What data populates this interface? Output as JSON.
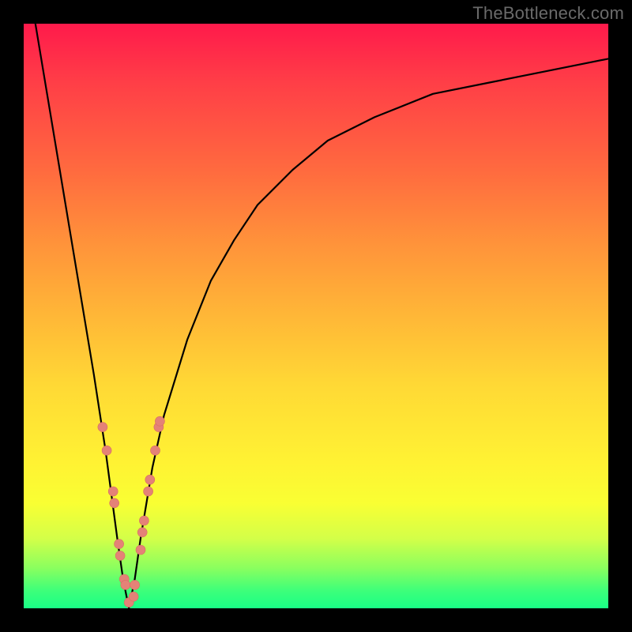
{
  "watermark": "TheBottleneck.com",
  "chart_data": {
    "type": "line",
    "title": "",
    "xlabel": "",
    "ylabel": "",
    "xlim": [
      0,
      100
    ],
    "ylim": [
      0,
      100
    ],
    "grid": false,
    "legend": false,
    "description": "V-shaped bottleneck curve over a red-to-green vertical gradient. Minimum (0% bottleneck) occurs near x≈18. Curve rises steeply to ~100% at x→0 and asymptotically toward ~94% as x→100. Scatter points cluster near the minimum on both branches.",
    "series": [
      {
        "name": "bottleneck_curve",
        "x": [
          2,
          4,
          6,
          8,
          10,
          12,
          14,
          16,
          17,
          18,
          19,
          20,
          22,
          24,
          28,
          32,
          36,
          40,
          46,
          52,
          60,
          70,
          80,
          90,
          100
        ],
        "y": [
          100,
          88,
          76,
          64,
          52,
          40,
          27,
          12,
          5,
          0,
          5,
          12,
          24,
          33,
          46,
          56,
          63,
          69,
          75,
          80,
          84,
          88,
          90,
          92,
          94
        ]
      }
    ],
    "scatter": [
      {
        "name": "left_branch_points",
        "points": [
          {
            "x": 13.5,
            "y": 31
          },
          {
            "x": 14.2,
            "y": 27
          },
          {
            "x": 15.3,
            "y": 20
          },
          {
            "x": 15.5,
            "y": 18
          },
          {
            "x": 16.3,
            "y": 11
          },
          {
            "x": 16.5,
            "y": 9
          },
          {
            "x": 17.2,
            "y": 5
          },
          {
            "x": 17.4,
            "y": 4
          },
          {
            "x": 18.0,
            "y": 1
          }
        ]
      },
      {
        "name": "right_branch_points",
        "points": [
          {
            "x": 18.8,
            "y": 2
          },
          {
            "x": 19.0,
            "y": 4
          },
          {
            "x": 20.0,
            "y": 10
          },
          {
            "x": 20.3,
            "y": 13
          },
          {
            "x": 20.6,
            "y": 15
          },
          {
            "x": 21.3,
            "y": 20
          },
          {
            "x": 21.6,
            "y": 22
          },
          {
            "x": 22.5,
            "y": 27
          },
          {
            "x": 23.1,
            "y": 31
          },
          {
            "x": 23.3,
            "y": 32
          }
        ]
      }
    ],
    "gradient_stops": [
      {
        "pos": 0,
        "color": "#ff1a4b"
      },
      {
        "pos": 25,
        "color": "#ff6a3f"
      },
      {
        "pos": 50,
        "color": "#ffb737"
      },
      {
        "pos": 75,
        "color": "#fff233"
      },
      {
        "pos": 93,
        "color": "#8cff5e"
      },
      {
        "pos": 100,
        "color": "#19ff86"
      }
    ]
  }
}
